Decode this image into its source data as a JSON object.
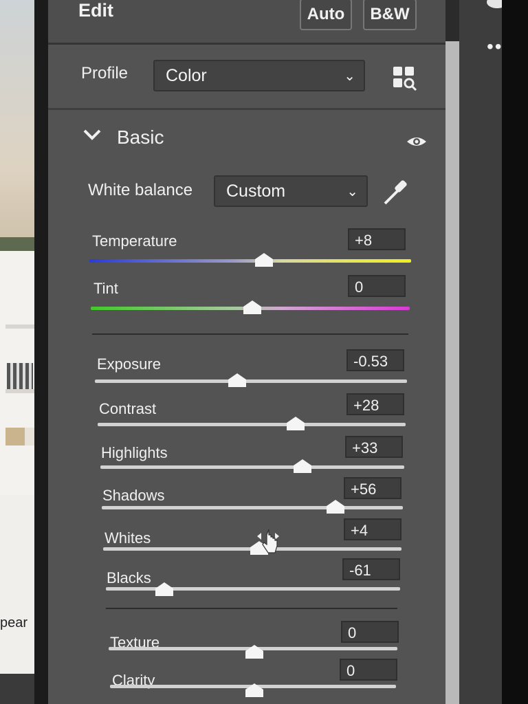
{
  "left_photo": {
    "caption": "pear"
  },
  "header": {
    "title": "Edit",
    "auto_label": "Auto",
    "bw_label": "B&W"
  },
  "profile": {
    "label": "Profile",
    "value": "Color",
    "browser_icon": "grid-search-icon"
  },
  "basic": {
    "section_title": "Basic",
    "white_balance_label": "White balance",
    "white_balance_value": "Custom",
    "temperature": {
      "label": "Temperature",
      "value": "+8"
    },
    "tint": {
      "label": "Tint",
      "value": "0"
    },
    "exposure": {
      "label": "Exposure",
      "value": "-0.53"
    },
    "contrast": {
      "label": "Contrast",
      "value": "+28"
    },
    "highlights": {
      "label": "Highlights",
      "value": "+33"
    },
    "shadows": {
      "label": "Shadows",
      "value": "+56"
    },
    "whites": {
      "label": "Whites",
      "value": "+4"
    },
    "blacks": {
      "label": "Blacks",
      "value": "-61"
    },
    "texture": {
      "label": "Texture",
      "value": "0"
    },
    "clarity": {
      "label": "Clarity",
      "value": "0"
    }
  },
  "right_bar": {
    "more_label": "•••"
  },
  "colors": {
    "panel": "#535353",
    "temp_cool": "#2b3bd8",
    "temp_warm": "#f0f01a",
    "tint_green": "#42c92a",
    "tint_magenta": "#d93ad6"
  }
}
